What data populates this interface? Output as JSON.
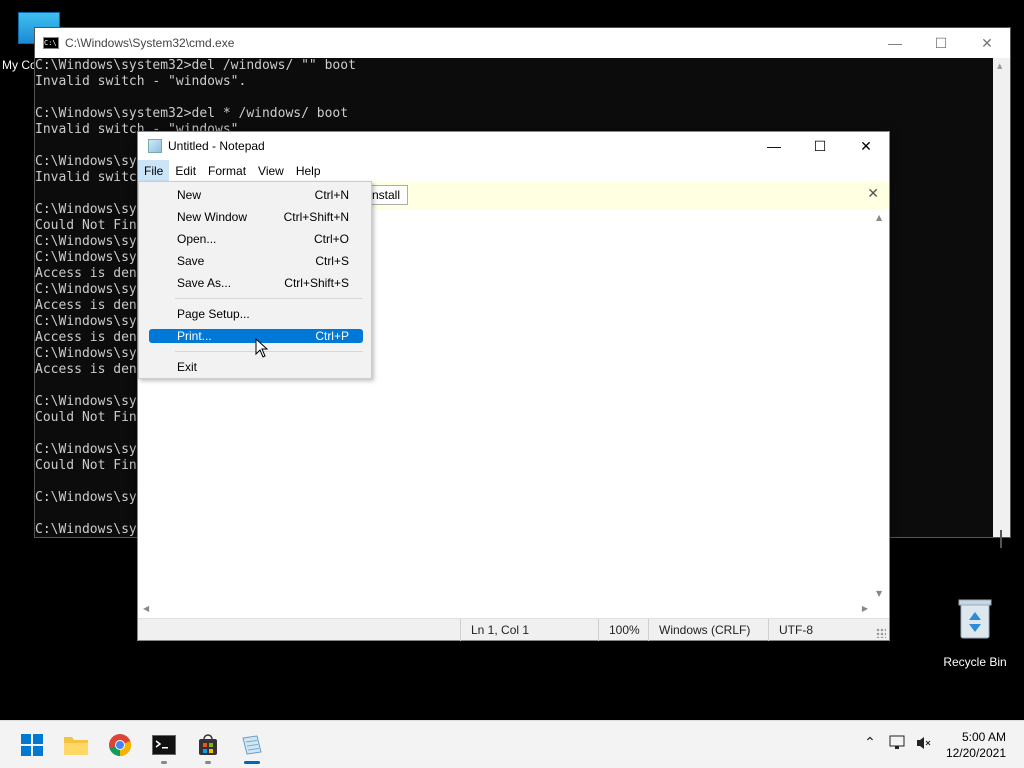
{
  "desktop": {
    "icons": {
      "my_computer": "My Co",
      "recycle_bin": "Recycle Bin"
    }
  },
  "cmd": {
    "title": "C:\\Windows\\System32\\cmd.exe",
    "lines": [
      "C:\\Windows\\system32>del /windows/ \"\" boot",
      "Invalid switch - \"windows\".",
      "",
      "C:\\Windows\\system32>del * /windows/ boot",
      "Invalid switch - \"windows\".",
      "",
      "C:\\Windows\\sy",
      "Invalid switc",
      "",
      "C:\\Windows\\sy",
      "Could Not Fin",
      "C:\\Windows\\sy",
      "C:\\Windows\\sy",
      "Access is den",
      "C:\\Windows\\sy",
      "Access is den",
      "C:\\Windows\\sy",
      "Access is den",
      "C:\\Windows\\sy",
      "Access is den",
      "",
      "C:\\Windows\\sy",
      "Could Not Fin",
      "",
      "C:\\Windows\\sy",
      "Could Not Fin",
      "",
      "C:\\Windows\\sy",
      "",
      "C:\\Windows\\sy"
    ]
  },
  "notepad": {
    "title": "Untitled - Notepad",
    "menu": [
      "File",
      "Edit",
      "Format",
      "View",
      "Help"
    ],
    "infobar_button": "nstall",
    "status": {
      "position": "Ln 1, Col 1",
      "zoom": "100%",
      "line_ending": "Windows (CRLF)",
      "encoding": "UTF-8"
    }
  },
  "file_menu": {
    "items": [
      {
        "label": "New",
        "shortcut": "Ctrl+N"
      },
      {
        "label": "New Window",
        "shortcut": "Ctrl+Shift+N"
      },
      {
        "label": "Open...",
        "shortcut": "Ctrl+O"
      },
      {
        "label": "Save",
        "shortcut": "Ctrl+S"
      },
      {
        "label": "Save As...",
        "shortcut": "Ctrl+Shift+S"
      },
      {
        "label": "Page Setup...",
        "shortcut": ""
      },
      {
        "label": "Print...",
        "shortcut": "Ctrl+P",
        "highlighted": true
      },
      {
        "label": "Exit",
        "shortcut": ""
      }
    ]
  },
  "taskbar": {
    "apps": [
      "start-icon",
      "file-explorer-icon",
      "chrome-icon",
      "terminal-icon",
      "store-icon",
      "notepad-icon"
    ],
    "clock_time": "5:00 AM",
    "clock_date": "12/20/2021",
    "accent": "#0067c0"
  },
  "colors": {
    "menu_highlight": "#0078d7",
    "infobar": "#ffffe1",
    "console_bg": "#0c0c0c",
    "console_fg": "#cccccc"
  }
}
